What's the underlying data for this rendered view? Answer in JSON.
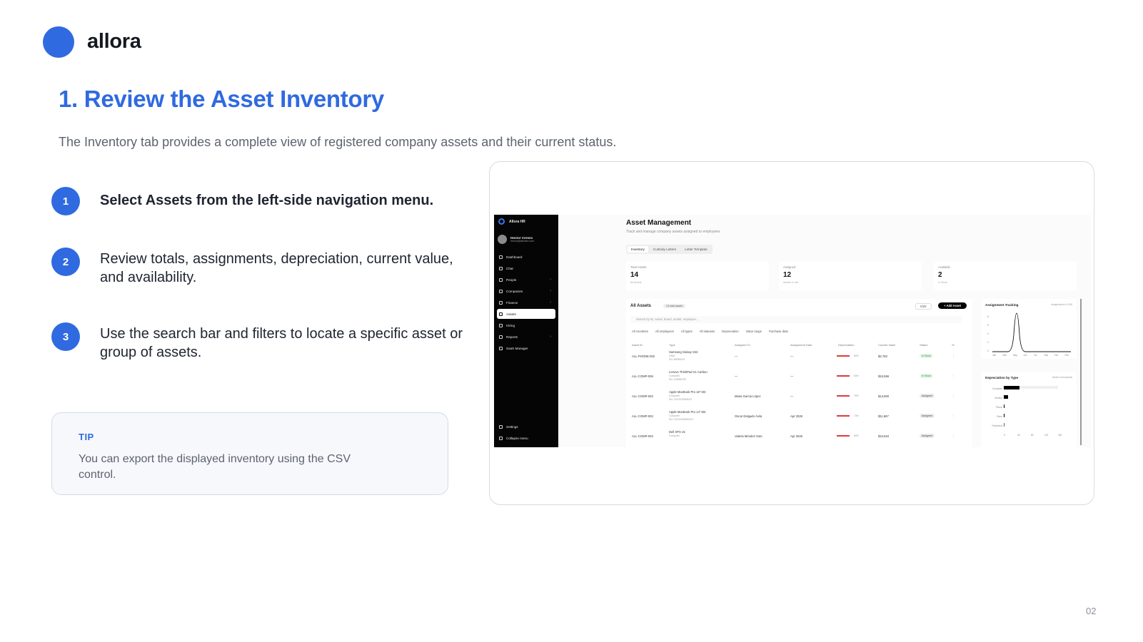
{
  "brand": {
    "name": "allora"
  },
  "heading": {
    "title": "1. Review the Asset Inventory",
    "subtitle": "The Inventory tab provides a complete view of registered company assets and their current status."
  },
  "steps": [
    {
      "number": "1",
      "text": "Select Assets from the left-side navigation menu."
    },
    {
      "number": "2",
      "text": "Review totals, assignments, depreciation, current value, and availability."
    },
    {
      "number": "3",
      "text": "Use the search bar and filters to locate a specific asset or group of assets."
    }
  ],
  "tip": {
    "label": "TIP",
    "text": "You can export the displayed inventory using the CSV control."
  },
  "page_number": "02",
  "screenshot": {
    "sidebar": {
      "brand": "Allora HR",
      "user_name": "Hector Cerezo",
      "user_email": "hector@allorahr.com",
      "items": [
        {
          "label": "Dashboard",
          "icon": "dashboard-icon",
          "chevron": ""
        },
        {
          "label": "Chat",
          "icon": "chat-icon",
          "chevron": ""
        },
        {
          "label": "People",
          "icon": "people-icon",
          "chevron": "›"
        },
        {
          "label": "Companies",
          "icon": "building-icon",
          "chevron": "›"
        },
        {
          "label": "Finance",
          "icon": "finance-icon",
          "chevron": "›"
        },
        {
          "label": "Assets",
          "icon": "assets-icon",
          "chevron": ""
        },
        {
          "label": "Hiring",
          "icon": "briefcase-icon",
          "chevron": ""
        },
        {
          "label": "Reports",
          "icon": "chart-icon",
          "chevron": "›"
        },
        {
          "label": "SaaS Manager",
          "icon": "cloud-icon",
          "chevron": ""
        }
      ],
      "settings": "Settings",
      "collapse": "Collapse menu"
    },
    "main": {
      "title": "Asset Management",
      "description": "Track and manage company assets assigned to employees",
      "tabs": [
        "Inventory",
        "Custody Letters",
        "Letter Template"
      ],
      "stats": [
        {
          "label": "Total Assets",
          "value": "14",
          "sub": "All Assets"
        },
        {
          "label": "Assigned",
          "value": "12",
          "sub": "Assets in use"
        },
        {
          "label": "Available",
          "value": "2",
          "sub": "In Stock"
        }
      ],
      "table": {
        "title": "All Assets",
        "pill": "14 total assets",
        "csv": "CSV",
        "add": "+ Add Asset",
        "search_placeholder": "Search by ID, serial, brand, model, employee...",
        "filters": [
          "All countries",
          "All employees",
          "All types",
          "All statuses",
          "Depreciation",
          "Value range",
          "Purchase date"
        ],
        "headers": [
          "Asset ID",
          "Type",
          "Assigned To",
          "Assignment Date",
          "Depreciation",
          "Current Value",
          "Status",
          "%"
        ],
        "rows": [
          {
            "id": "ALL-PHONE-002",
            "type": "Samsung Galaxy S24",
            "sub": "Other",
            "serial": "SN: 5B999023",
            "assigned": "—",
            "date": "—",
            "dep": "80%",
            "value": "$2,793",
            "status": "In Stock",
            "status_kind": "stock"
          },
          {
            "id": "ALL-COMP-006",
            "type": "Lenovo ThinkPad X1 Carbon",
            "sub": "Computer",
            "serial": "SN: 1A9955789",
            "assigned": "—",
            "date": "—",
            "dep": "84%",
            "value": "$15,556",
            "status": "In Stock",
            "status_kind": "stock"
          },
          {
            "id": "ALL-COMP-003",
            "type": "Apple MacBook Pro 18\" M3",
            "sub": "Computer",
            "serial": "SN: C02XK3Z5MD6T",
            "assigned": "Maria Garcia López",
            "date": "—",
            "dep": "75%",
            "value": "$13,800",
            "status": "Assigned",
            "status_kind": "assigned"
          },
          {
            "id": "ALL-COMP-002",
            "type": "Apple MacBook Pro 14\" M3",
            "sub": "Computer",
            "serial": "SN: C02XK3Z5MD6T4",
            "assigned": "Oscar Delgado Ávila",
            "date": "Apr 2026",
            "dep": "73%",
            "value": "$11,667",
            "status": "Assigned",
            "status_kind": "assigned"
          },
          {
            "id": "ALL-COMP-003",
            "type": "Dell XPS 15",
            "sub": "Computer",
            "serial": "",
            "assigned": "Valeria Méndez Soto",
            "date": "Apr 2026",
            "dep": "80%",
            "value": "$10,834",
            "status": "Assigned",
            "status_kind": "assigned"
          }
        ]
      },
      "tracking": {
        "title": "Assignment Tracking",
        "sub": "Assignments in 2026",
        "months": [
          "Jan",
          "Mar",
          "May",
          "Jun",
          "Jul",
          "Sep",
          "Oct",
          "Dec"
        ],
        "y_ticks": [
          "8",
          "6",
          "4",
          "2",
          "0"
        ]
      },
      "dep_by_type": {
        "title": "Depreciation by Type",
        "sub": "Values in thousands",
        "categories": [
          "Computer",
          "Monitor",
          "Phone",
          "Other",
          "Peripheral"
        ],
        "x_ticks": [
          "0",
          "40",
          "80",
          "120",
          "160"
        ]
      }
    }
  }
}
